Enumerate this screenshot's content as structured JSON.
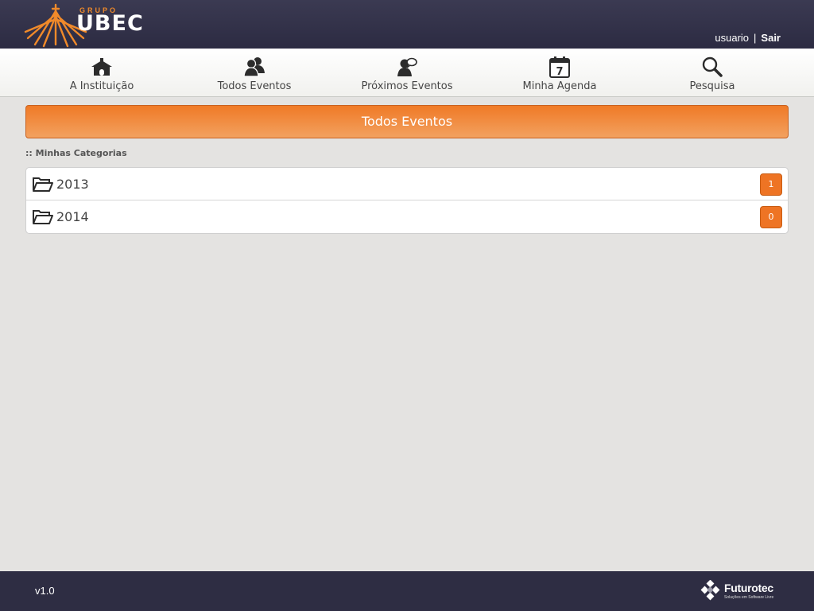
{
  "header": {
    "logo_small": "GRUPO",
    "logo_main": "UBEC",
    "username": "usuario",
    "separator": "|",
    "logout_label": "Sair"
  },
  "nav": {
    "items": [
      {
        "label": "A Instituição",
        "icon": "building-icon"
      },
      {
        "label": "Todos Eventos",
        "icon": "people-icon"
      },
      {
        "label": "Próximos Eventos",
        "icon": "person-chat-icon"
      },
      {
        "label": "Minha Agenda",
        "icon": "calendar-icon"
      },
      {
        "label": "Pesquisa",
        "icon": "search-icon"
      }
    ],
    "calendar_day": "7"
  },
  "page": {
    "title": "Todos Eventos",
    "section_label": ":: Minhas Categorias"
  },
  "categories": [
    {
      "label": "2013",
      "count": "1",
      "icon": "folder-open-icon"
    },
    {
      "label": "2014",
      "count": "0",
      "icon": "folder-open-icon"
    }
  ],
  "footer": {
    "version": "v1.0",
    "brand_name": "Futurotec",
    "brand_tagline": "Soluções em Software Livre"
  },
  "colors": {
    "header_bg": "#33324a",
    "accent_orange": "#f07a26",
    "footer_bg": "#2e2d43",
    "page_bg": "#e4e3e1"
  }
}
